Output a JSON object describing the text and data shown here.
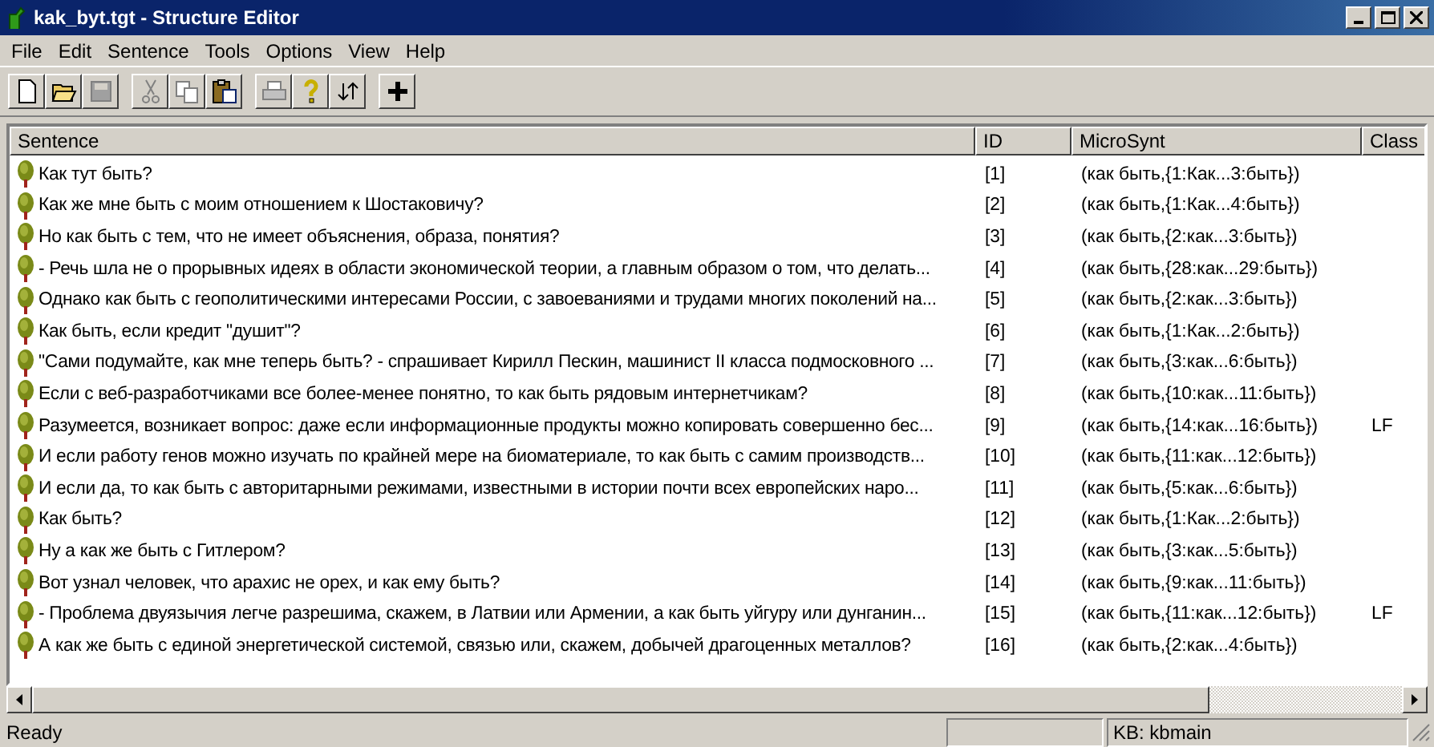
{
  "window": {
    "title": "kak_byt.tgt - Structure Editor"
  },
  "menu": [
    "File",
    "Edit",
    "Sentence",
    "Tools",
    "Options",
    "View",
    "Help"
  ],
  "toolbar": [
    [
      {
        "kind": "new",
        "disabled": false
      },
      {
        "kind": "open",
        "disabled": false
      },
      {
        "kind": "save",
        "disabled": true
      }
    ],
    [
      {
        "kind": "cut",
        "disabled": true
      },
      {
        "kind": "copy",
        "disabled": true
      },
      {
        "kind": "paste",
        "disabled": false
      }
    ],
    [
      {
        "kind": "print",
        "disabled": true
      },
      {
        "kind": "help",
        "disabled": false
      },
      {
        "kind": "swap",
        "disabled": false
      }
    ],
    [
      {
        "kind": "add",
        "disabled": false
      }
    ]
  ],
  "table": {
    "columns": [
      "Sentence",
      "ID",
      "MicroSynt",
      "Class"
    ],
    "rows": [
      {
        "sentence": "Как тут быть?",
        "id": "[1]",
        "microsynt": "(как быть,{1:Как...3:быть})"
      },
      {
        "sentence": "Как же мне быть с моим отношением к Шостаковичу?",
        "id": "[2]",
        "microsynt": "(как быть,{1:Как...4:быть})"
      },
      {
        "sentence": "Но как быть с тем, что не имеет объяснения, образа, понятия?",
        "id": "[3]",
        "microsynt": "(как быть,{2:как...3:быть})"
      },
      {
        "sentence": " - Речь шла не о прорывных идеях в области экономической теории, а главным образом о том, что делать...",
        "id": "[4]",
        "microsynt": "(как быть,{28:как...29:быть})"
      },
      {
        "sentence": "Однако как быть с геополитическими интересами России, с завоеваниями и трудами многих поколений на...",
        "id": "[5]",
        "microsynt": "(как быть,{2:как...3:быть})"
      },
      {
        "sentence": "Как быть, если кредит \"душит\"?",
        "id": "[6]",
        "microsynt": "(как быть,{1:Как...2:быть})"
      },
      {
        "sentence": "\"Сами подумайте, как мне теперь быть? - спрашивает Кирилл Пескин, машинист II класса подмосковного ...",
        "id": "[7]",
        "microsynt": "(как быть,{3:как...6:быть})"
      },
      {
        "sentence": "Если с веб-разработчиками все более-менее понятно, то как быть рядовым интернетчикам?",
        "id": "[8]",
        "microsynt": "(как быть,{10:как...11:быть})"
      },
      {
        "sentence": "Разумеется, возникает вопрос: даже если информационные продукты можно копировать совершенно бес...",
        "id": "[9]",
        "microsynt": "(как быть,{14:как...16:быть})",
        "class": "LF"
      },
      {
        "sentence": "И если работу генов можно изучать по крайней мере на биоматериале, то как быть с самим производств...",
        "id": "[10]",
        "microsynt": "(как быть,{11:как...12:быть})"
      },
      {
        "sentence": "И если да, то как быть с авторитарными режимами, известными в истории почти всех европейских наро...",
        "id": "[11]",
        "microsynt": "(как быть,{5:как...6:быть})"
      },
      {
        "sentence": "Как быть?",
        "id": "[12]",
        "microsynt": "(как быть,{1:Как...2:быть})"
      },
      {
        "sentence": "Ну а как же быть с Гитлером?",
        "id": "[13]",
        "microsynt": "(как быть,{3:как...5:быть})"
      },
      {
        "sentence": "Вот узнал человек, что арахис не орех, и как ему быть?",
        "id": "[14]",
        "microsynt": "(как быть,{9:как...11:быть})"
      },
      {
        "sentence": " - Проблема двуязычия легче разрешима, скажем, в Латвии или Армении, а как быть уйгуру или дунганин...",
        "id": "[15]",
        "microsynt": "(как быть,{11:как...12:быть})",
        "class": "LF"
      },
      {
        "sentence": "А как же быть с единой энергетической системой, связью или, скажем, добычей драгоценных металлов?",
        "id": "[16]",
        "microsynt": "(как быть,{2:как...4:быть})"
      }
    ]
  },
  "status_bar": {
    "message": "Ready",
    "kb": "KB: kbmain"
  }
}
